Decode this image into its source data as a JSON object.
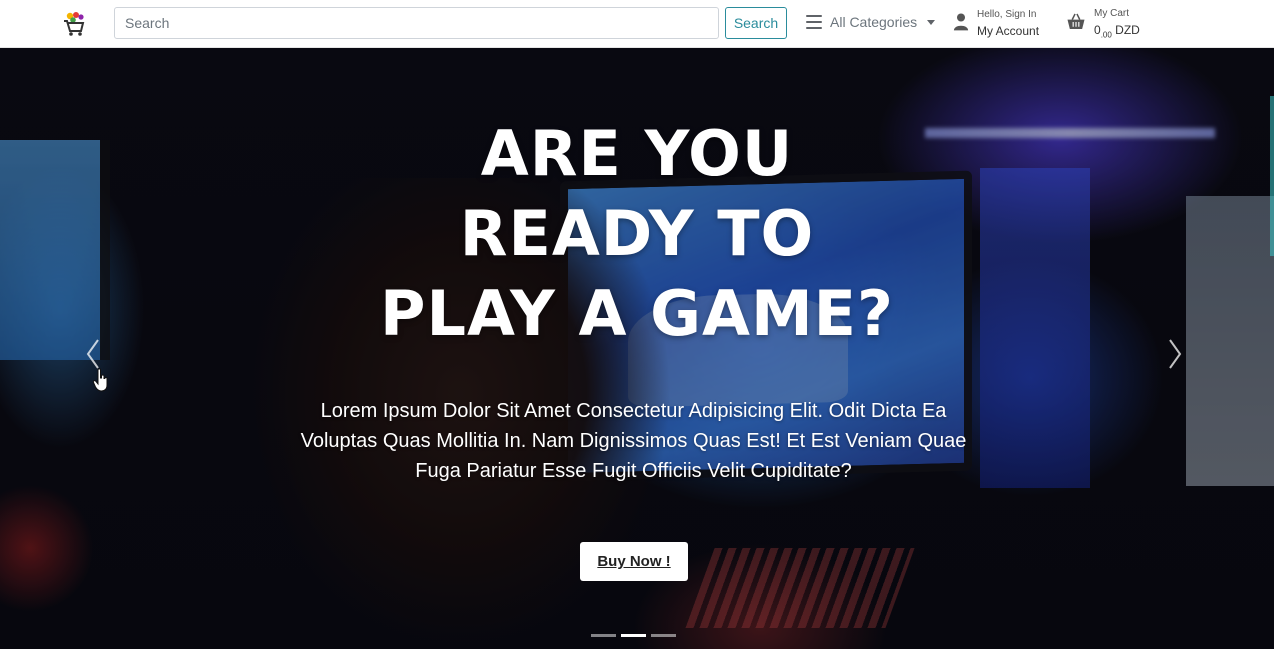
{
  "navbar": {
    "search": {
      "placeholder": "Search",
      "button_label": "Search"
    },
    "categories": {
      "label": "All Categories"
    },
    "account": {
      "greeting": "Hello, Sign In",
      "label": "My Account"
    },
    "cart": {
      "label": "My Cart",
      "amount_main": "0",
      "amount_decimals": ".00",
      "currency": "DZD"
    }
  },
  "hero": {
    "title_lines": [
      "ARE YOU",
      "READY TO",
      "PLAY A GAME?"
    ],
    "text_lines": [
      "Lorem Ipsum Dolor Sit Amet Consectetur Adipisicing Elit. Odit Dicta Ea",
      "Voluptas Quas Mollitia In. Nam Dignissimos Quas Est! Et Est Veniam Quae",
      "Fuga Pariatur Esse Fugit Officiis Velit Cupiditate?"
    ],
    "buy_label": "Buy Now !"
  },
  "carousel": {
    "slide_count": 3,
    "active_index": 1
  },
  "icons": {
    "logo": "cart-logo-icon",
    "categories": "hamburger-menu-icon",
    "account": "user-icon",
    "cart": "basket-icon",
    "prev": "chevron-left-icon",
    "next": "chevron-right-icon"
  },
  "colors": {
    "search_accent": "#2a8c9c",
    "hero_overlay": "#000000",
    "text_light": "#ffffff"
  }
}
